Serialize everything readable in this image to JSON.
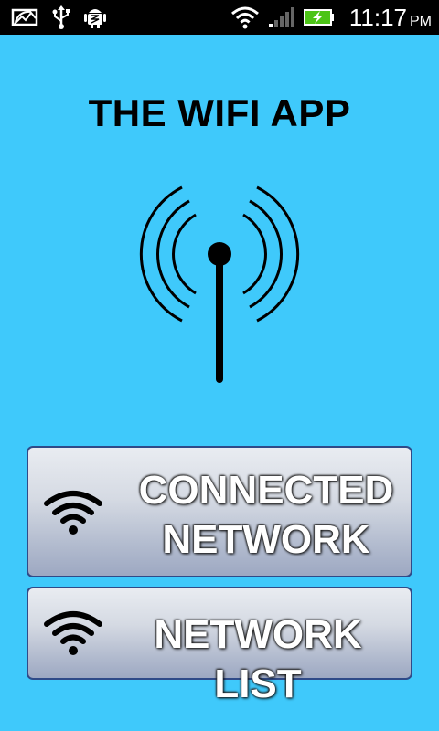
{
  "status_bar": {
    "time": "11:17",
    "ampm": "PM",
    "icons": [
      "image-icon",
      "usb-icon",
      "android-debug-icon",
      "wifi-signal-icon",
      "cell-signal-icon",
      "battery-charging-icon"
    ]
  },
  "title": "THE WIFI APP",
  "logo": {
    "icon": "antenna-broadcast-icon"
  },
  "buttons": {
    "connected": {
      "line1": "CONNECTED",
      "line2": "NETWORK",
      "icon": "wifi-icon"
    },
    "list": {
      "label": "NETWORK LIST",
      "icon": "wifi-icon"
    }
  },
  "colors": {
    "background": "#3fc9fb",
    "status_bar": "#000000",
    "button_border": "#2f4a88",
    "battery": "#4cc417"
  }
}
